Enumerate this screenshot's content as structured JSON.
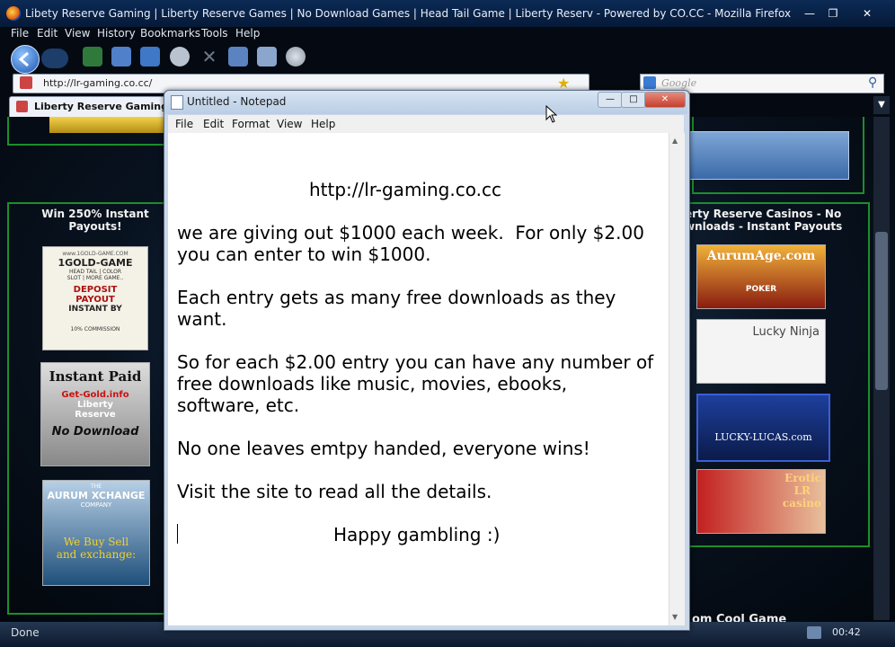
{
  "firefox": {
    "window_title": "Libety Reserve Gaming | Liberty Reserve Games | No Download Games | Head Tail Game | Liberty Reserv - Powered by CO.CC - Mozilla Firefox",
    "menu": [
      "File",
      "Edit",
      "View",
      "History",
      "Bookmarks",
      "Tools",
      "Help"
    ],
    "url": "http://lr-gaming.co.cc/",
    "search_placeholder": "Google",
    "tab_label": "Liberty Reserve Gaming | L",
    "status": "Done",
    "clock": "00:42"
  },
  "webpage": {
    "left_heading": "Win 250% Instant Payouts!",
    "right_heading": "erty Reserve Casinos - No\nwnloads - Instant Payouts",
    "left_ads": [
      {
        "lines": [
          "www.1GOLD-GAME.COM",
          "1GOLD-GAME",
          "HEAD TAIL | COLOR",
          "SLOT | MORE GAME..",
          "DEPOSIT",
          "PAYOUT",
          "INSTANT BY",
          "10% COMMISSION"
        ]
      },
      {
        "lines": [
          "Instant Paid",
          "Get-Gold.info",
          "Liberty",
          "Reserve",
          "No Download"
        ]
      },
      {
        "lines": [
          "THE",
          "AURUM XCHANGE",
          "COMPANY",
          "We Buy Sell",
          "and exchange:"
        ]
      }
    ],
    "right_ads": [
      {
        "lines": [
          "AurumAge.com",
          "POKER"
        ]
      },
      {
        "lines": [
          "Lucky Ninja"
        ]
      },
      {
        "lines": [
          "LUCKY-LUCAS.com"
        ]
      },
      {
        "lines": [
          "Erotic",
          "LR",
          "casino"
        ]
      }
    ],
    "bottom_right_text": "om Cool Game"
  },
  "notepad": {
    "title": "Untitled - Notepad",
    "menu": [
      "File",
      "Edit",
      "Format",
      "View",
      "Help"
    ],
    "lines": [
      "http://lr-gaming.co.cc",
      "we are giving out $1000 each week.  For only $2.00",
      "you can enter to win $1000.",
      "Each entry gets as many free downloads as they",
      "want.",
      "So for each $2.00 entry you can have any number of",
      "free downloads like music, movies, ebooks,",
      "software, etc.",
      "No one leaves emtpy handed, everyone wins!",
      "Visit the site to read all the details.",
      "Happy gambling :)"
    ]
  },
  "colors": {
    "page_frame": "#1c8f2a",
    "titlebar": "#0b2a55"
  }
}
